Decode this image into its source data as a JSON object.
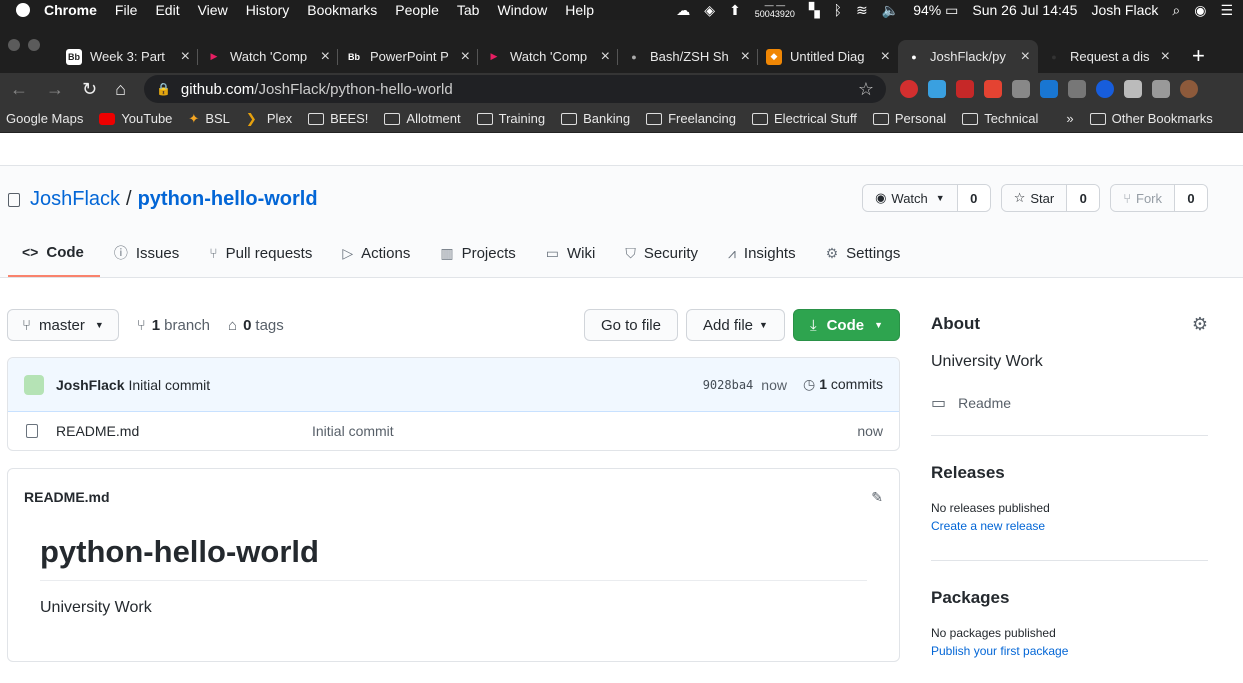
{
  "menubar": {
    "app": "Chrome",
    "items": [
      "File",
      "Edit",
      "View",
      "History",
      "Bookmarks",
      "People",
      "Tab",
      "Window",
      "Help"
    ],
    "status_top": "— —",
    "status_num": "50043920",
    "battery": "94%",
    "datetime": "Sun 26 Jul  14:45",
    "user": "Josh Flack"
  },
  "tabs": [
    {
      "title": "Week 3: Part",
      "fav": "Bb",
      "color": "#222"
    },
    {
      "title": "Watch 'Comp",
      "fav": "▶",
      "color": "#c2185b"
    },
    {
      "title": "PowerPoint P",
      "fav": "Bb",
      "color": "#222"
    },
    {
      "title": "Watch 'Comp",
      "fav": "▶",
      "color": "#c2185b"
    },
    {
      "title": "Bash/ZSH Sh",
      "fav": "●",
      "color": "#555"
    },
    {
      "title": "Untitled Diag",
      "fav": "◆",
      "color": "#f08705"
    },
    {
      "title": "JoshFlack/py",
      "fav": "●",
      "color": "#fff"
    },
    {
      "title": "Request a dis",
      "fav": "●",
      "color": "#333"
    }
  ],
  "address": {
    "host": "github.com",
    "path": "/JoshFlack/python-hello-world"
  },
  "bookmarks": [
    "Google Maps",
    "YouTube",
    "BSL",
    "Plex",
    "BEES!",
    "Allotment",
    "Training",
    "Banking",
    "Freelancing",
    "Electrical Stuff",
    "Personal",
    "Technical"
  ],
  "bookmarks_more": "»",
  "bookmarks_other": "Other Bookmarks",
  "repo": {
    "owner": "JoshFlack",
    "sep": "/",
    "name": "python-hello-world",
    "watch_label": "Watch",
    "watch_count": "0",
    "star_label": "Star",
    "star_count": "0",
    "fork_label": "Fork",
    "fork_count": "0"
  },
  "nav": [
    {
      "label": "Code",
      "icon": "<>"
    },
    {
      "label": "Issues",
      "icon": "ⓘ"
    },
    {
      "label": "Pull requests",
      "icon": "⑂"
    },
    {
      "label": "Actions",
      "icon": "▷"
    },
    {
      "label": "Projects",
      "icon": "▥"
    },
    {
      "label": "Wiki",
      "icon": "▭"
    },
    {
      "label": "Security",
      "icon": "⛉"
    },
    {
      "label": "Insights",
      "icon": "⩘"
    },
    {
      "label": "Settings",
      "icon": "⚙"
    }
  ],
  "filebar": {
    "branch": "master",
    "branches_count": "1",
    "branches_label": "branch",
    "tags_count": "0",
    "tags_label": "tags",
    "goto": "Go to file",
    "addfile": "Add file",
    "code": "Code"
  },
  "commit": {
    "author": "JoshFlack",
    "message": "Initial commit",
    "sha": "9028ba4",
    "time": "now",
    "count": "1",
    "count_label": "commits"
  },
  "files": [
    {
      "name": "README.md",
      "message": "Initial commit",
      "date": "now"
    }
  ],
  "readme": {
    "filename": "README.md",
    "heading": "python-hello-world",
    "body": "University Work"
  },
  "sidebar": {
    "about_title": "About",
    "description": "University Work",
    "readme_label": "Readme",
    "releases_title": "Releases",
    "releases_none": "No releases published",
    "releases_link": "Create a new release",
    "packages_title": "Packages",
    "packages_none": "No packages published",
    "packages_link": "Publish your first package"
  }
}
